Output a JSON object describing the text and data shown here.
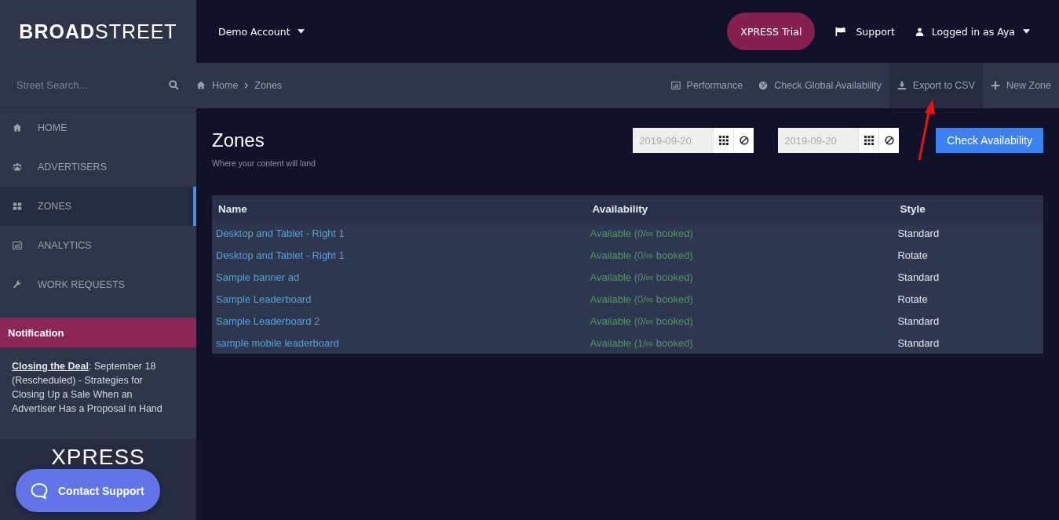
{
  "brand": {
    "bold": "BROAD",
    "light": "STREET"
  },
  "search": {
    "placeholder": "Street Search..."
  },
  "nav": [
    {
      "label": "HOME",
      "kind": "home",
      "selected": false
    },
    {
      "label": "ADVERTISERS",
      "kind": "users",
      "selected": false
    },
    {
      "label": "ZONES",
      "kind": "grid",
      "selected": true
    },
    {
      "label": "ANALYTICS",
      "kind": "chart",
      "selected": false
    },
    {
      "label": "WORK REQUESTS",
      "kind": "wrench",
      "selected": false
    }
  ],
  "notification": {
    "title": "Notification",
    "link": "Closing the Deal",
    "text": ": September 18 (Rescheduled) - Strategies for Closing Up a Sale When an Advertiser Has a Proposal in Hand"
  },
  "promo": {
    "logo": "XPRESS"
  },
  "contact_button": "Contact Support",
  "account_menu": "Demo Account",
  "top_actions": {
    "trial": "XPRESS Trial",
    "support": "Support",
    "user": "Logged in as Aya"
  },
  "breadcrumb": [
    "Home",
    "Zones"
  ],
  "toolbar": [
    {
      "label": "Performance",
      "kind": "chart",
      "highlighted": false
    },
    {
      "label": "Check Global Availability",
      "kind": "globe",
      "highlighted": false
    },
    {
      "label": "Export to CSV",
      "kind": "download",
      "highlighted": true
    },
    {
      "label": "New Zone",
      "kind": "plus",
      "highlighted": false
    }
  ],
  "page": {
    "title": "Zones",
    "subtitle": "Where your content will land"
  },
  "date_range": [
    {
      "value": "2019-09-20"
    },
    {
      "value": "2019-09-20"
    }
  ],
  "check_button": "Check Availability",
  "table": {
    "columns": [
      "Name",
      "Availability",
      "Style"
    ],
    "rows": [
      {
        "name": "Desktop and Tablet - Right 1",
        "availability": "Available (0/∞ booked)",
        "style": "Standard"
      },
      {
        "name": "Desktop and Tablet - Right 1",
        "availability": "Available (0/∞ booked)",
        "style": "Rotate"
      },
      {
        "name": "Sample banner ad",
        "availability": "Available (0/∞ booked)",
        "style": "Standard"
      },
      {
        "name": "Sample Leaderboard",
        "availability": "Available (0/∞ booked)",
        "style": "Rotate"
      },
      {
        "name": "Sample Leaderboard 2",
        "availability": "Available (0/∞ booked)",
        "style": "Standard"
      },
      {
        "name": "sample mobile leaderboard",
        "availability": "Available (1/∞ booked)",
        "style": "Standard"
      }
    ]
  }
}
